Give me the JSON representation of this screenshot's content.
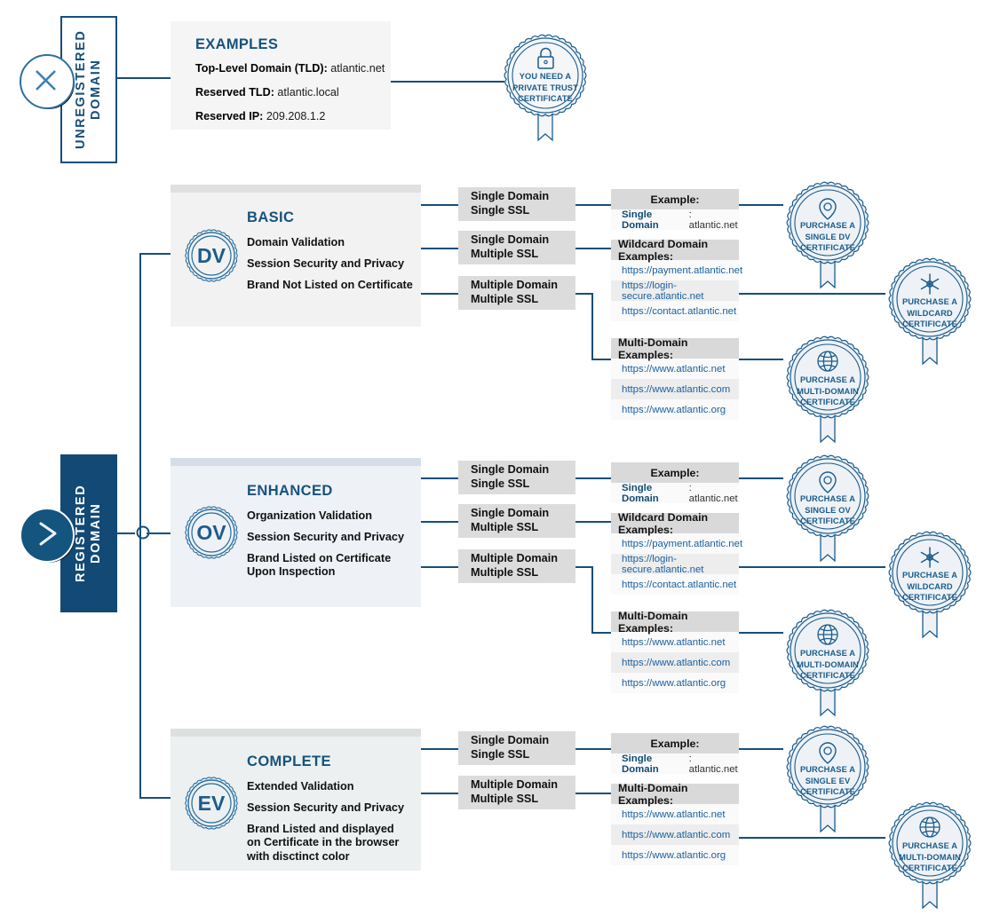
{
  "diagram": {
    "title": "SSL Certificate Selection Flowchart",
    "accent": "#174e7a",
    "accent_light": "#1b5c8c",
    "brand_blue": "#16537e"
  },
  "rails": {
    "unregistered": {
      "label": "UNREGISTERED DOMAIN",
      "icon": "close-x-icon"
    },
    "registered": {
      "label": "REGISTERED DOMAIN",
      "icon": "chevron-right-icon"
    }
  },
  "examples_panel": {
    "title": "EXAMPLES",
    "rows": [
      {
        "label": "Top-Level Domain (TLD):",
        "value": "atlantic.net"
      },
      {
        "label": "Reserved TLD:",
        "value": "atlantic.local"
      },
      {
        "label": "Reserved IP:",
        "value": "209.208.1.2"
      }
    ]
  },
  "private_trust_badge": {
    "icon": "lock-icon",
    "lines": [
      "YOU NEED A",
      "PRIVATE TRUST",
      "CERTIFICATE"
    ]
  },
  "levels": [
    {
      "seal": "DV",
      "title": "BASIC",
      "features": [
        "Domain Validation",
        "Session Security and Privacy",
        "Brand Not Listed on Certificate"
      ],
      "ssl_types": [
        "Single Domain\nSingle SSL",
        "Single Domain\nMultiple SSL",
        "Multiple Domain\nMultiple SSL"
      ]
    },
    {
      "seal": "OV",
      "title": "ENHANCED",
      "features": [
        "Organization Validation",
        "Session Security and Privacy",
        "Brand Listed on Certificate Upon Inspection"
      ],
      "ssl_types": [
        "Single Domain\nSingle SSL",
        "Single Domain\nMultiple SSL",
        "Multiple Domain\nMultiple SSL"
      ]
    },
    {
      "seal": "EV",
      "title": "COMPLETE",
      "features": [
        "Extended Validation",
        "Session Security and Privacy",
        "Brand Listed and displayed on Certificate in the browser with disctinct color"
      ],
      "ssl_types": [
        "Single Domain\nSingle SSL",
        "Multiple Domain\nMultiple SSL"
      ]
    }
  ],
  "example_tables": {
    "single": {
      "header": "Example:",
      "rows": [
        {
          "label": "Single Domain",
          "value": ": atlantic.net"
        }
      ]
    },
    "wildcard": {
      "header": "Wildcard Domain Examples:",
      "rows": [
        "https://payment.atlantic.net",
        "https://login-secure.atlantic.net",
        "https://contact.atlantic.net"
      ]
    },
    "multi": {
      "header": "Multi-Domain Examples:",
      "rows": [
        "https://www.atlantic.net",
        "https://www.atlantic.com",
        "https://www.atlantic.org"
      ]
    }
  },
  "purchase_badges": {
    "single_dv": {
      "icon": "map-pin-icon",
      "lines": [
        "PURCHASE A",
        "SINGLE DV",
        "CERTIFICATE"
      ]
    },
    "single_ov": {
      "icon": "map-pin-icon",
      "lines": [
        "PURCHASE A",
        "SINGLE OV",
        "CERTIFICATE"
      ]
    },
    "single_ev": {
      "icon": "map-pin-icon",
      "lines": [
        "PURCHASE A",
        "SINGLE EV",
        "CERTIFICATE"
      ]
    },
    "wildcard": {
      "icon": "asterisk-icon",
      "lines": [
        "PURCHASE A",
        "WILDCARD",
        "CERTIFICATE"
      ]
    },
    "multi_domain": {
      "icon": "globe-icon",
      "lines": [
        "PURCHASE A",
        "MULTI-DOMAIN",
        "CERTIFICATE"
      ]
    }
  }
}
